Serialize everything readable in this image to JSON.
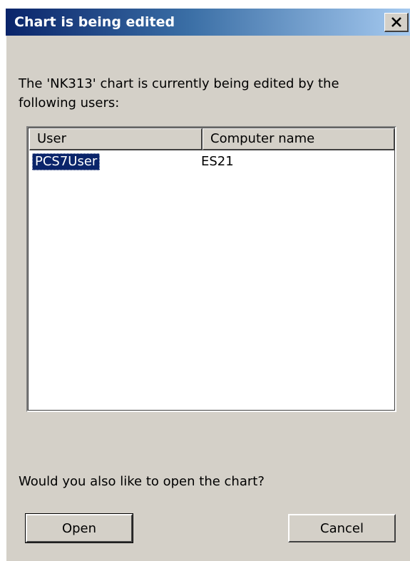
{
  "dialog": {
    "title": "Chart is being edited",
    "message": "The 'NK313' chart is currently being edited by the following users:",
    "question": "Would you also like to open the chart?",
    "buttons": {
      "open": "Open",
      "cancel": "Cancel"
    }
  },
  "users_table": {
    "columns": [
      "User",
      "Computer name"
    ],
    "rows": [
      {
        "user": "PCS7User",
        "computer": "ES21",
        "selected": true
      }
    ]
  },
  "icons": {
    "close": "close-icon"
  },
  "colors": {
    "dialog_background": "#d4d0c8",
    "title_gradient_start": "#0a246a",
    "title_gradient_end": "#a6caf0",
    "selection": "#0a246a"
  }
}
